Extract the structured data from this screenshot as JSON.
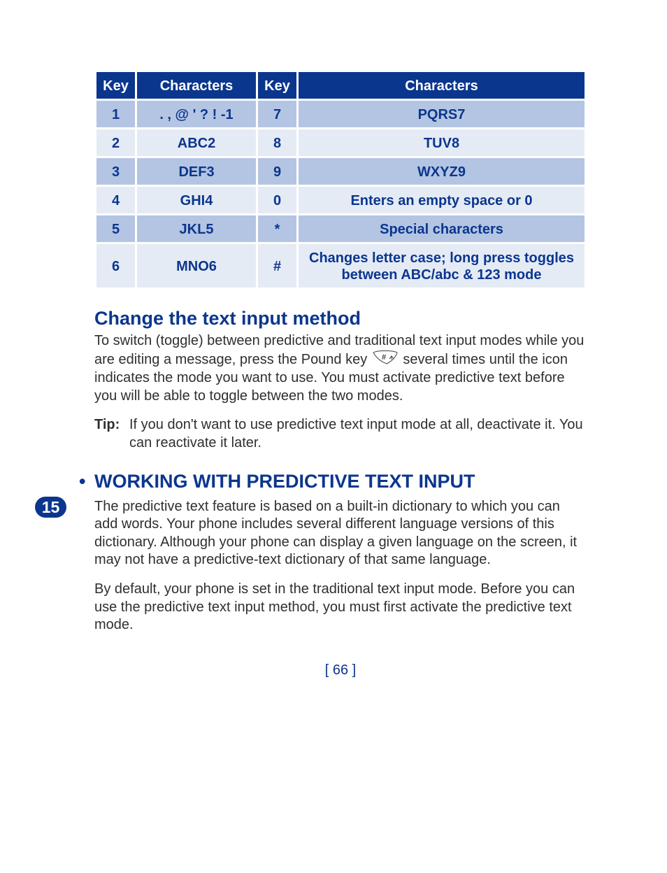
{
  "table": {
    "headers": {
      "k1": "Key",
      "c1": "Characters",
      "k2": "Key",
      "c2": "Characters"
    },
    "rows": [
      {
        "k1": "1",
        "c1": ". , @ ' ? ! -1",
        "k2": "7",
        "c2": "PQRS7"
      },
      {
        "k1": "2",
        "c1": "ABC2",
        "k2": "8",
        "c2": "TUV8"
      },
      {
        "k1": "3",
        "c1": "DEF3",
        "k2": "9",
        "c2": "WXYZ9"
      },
      {
        "k1": "4",
        "c1": "GHI4",
        "k2": "0",
        "c2": "Enters an empty space or 0"
      },
      {
        "k1": "5",
        "c1": "JKL5",
        "k2": "*",
        "c2": "Special characters"
      },
      {
        "k1": "6",
        "c1": "MNO6",
        "k2": "#",
        "c2": "Changes letter case; long press toggles between ABC/abc & 123 mode"
      }
    ]
  },
  "section1": {
    "heading": "Change the text input method",
    "body_before": "To switch (toggle) between predictive and traditional text input modes while you are editing a message, press the Pound key ",
    "body_after": " several times until the icon indicates the mode you want to use. You must activate predictive text before you will be able to toggle between the two modes.",
    "tip_label": "Tip:",
    "tip_text": "If you don't want to use predictive text input mode at all, deactivate it. You can reactivate it later."
  },
  "section2": {
    "heading": "WORKING WITH PREDICTIVE TEXT INPUT",
    "p1": "The predictive text feature is based on a built-in dictionary to which you can add words. Your phone includes several different language versions of this dictionary. Although your phone can display a given language on the screen, it may not have a predictive-text dictionary of that same language.",
    "p2": "By default, your phone is set in the traditional text input mode. Before you can use the predictive text input method, you must first activate the predictive text mode."
  },
  "thumb": "15",
  "pagenum": "[ 66 ]"
}
